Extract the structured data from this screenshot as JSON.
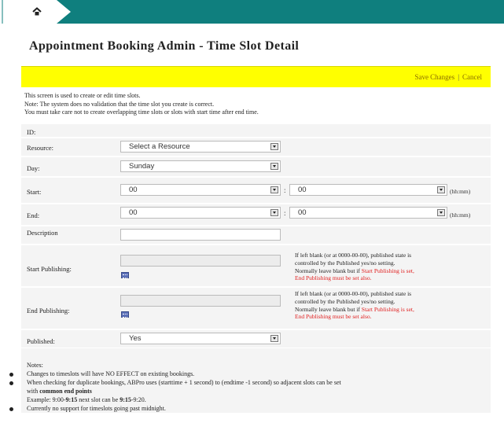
{
  "header": {
    "home_icon": "home-icon"
  },
  "page": {
    "title": "Appointment Booking Admin - Time Slot Detail"
  },
  "toolbar": {
    "save_label": "Save Changes",
    "separator": "|",
    "cancel_label": "Cancel"
  },
  "intro": {
    "line1": "This screen is used to create or edit time slots.",
    "line2": "Note: The system does no validation that the time slot you create is correct.",
    "line3": "You must take care not to create overlapping time slots or slots with start time after end time."
  },
  "form": {
    "id_label": "ID:",
    "resource_label": "Resource:",
    "resource_value": "Select a Resource",
    "day_label": "Day:",
    "day_value": "Sunday",
    "start_label": "Start:",
    "start_hour": "00",
    "start_min": "00",
    "end_label": "End:",
    "end_hour": "00",
    "end_min": "00",
    "colon": ":",
    "time_hint": "(hh:mm)",
    "description_label": "Description",
    "start_pub_label": "Start Publishing:",
    "end_pub_label": "End Publishing:",
    "published_label": "Published:",
    "published_value": "Yes",
    "pub_help_line1": "If left blank (or at 0000-00-00), published state is",
    "pub_help_line2": "controlled by the Published yes/no setting.",
    "pub_help_line3": "Normally leave blank but if ",
    "pub_help_red1": "Start Publishing is set,",
    "pub_help_red2": "End Publishing must be set also."
  },
  "notes": {
    "heading": "Notes:",
    "item1": "Changes to timeslots will have NO EFFECT on existing bookings.",
    "item2a": "When checking for duplicate bookings, ABPro uses (starttime + 1 second) to (endtime -1 second) so adjacent slots can be set",
    "item2b_pre": "with ",
    "item2b_bold": "common end points",
    "item2c_pre": "Example: 9:00-",
    "item2c_b1": "9:15",
    "item2c_mid": " next slot can be ",
    "item2c_b2": "9:15",
    "item2c_post": "-9:20.",
    "item3": "Currently no support for timeslots going past midnight."
  }
}
